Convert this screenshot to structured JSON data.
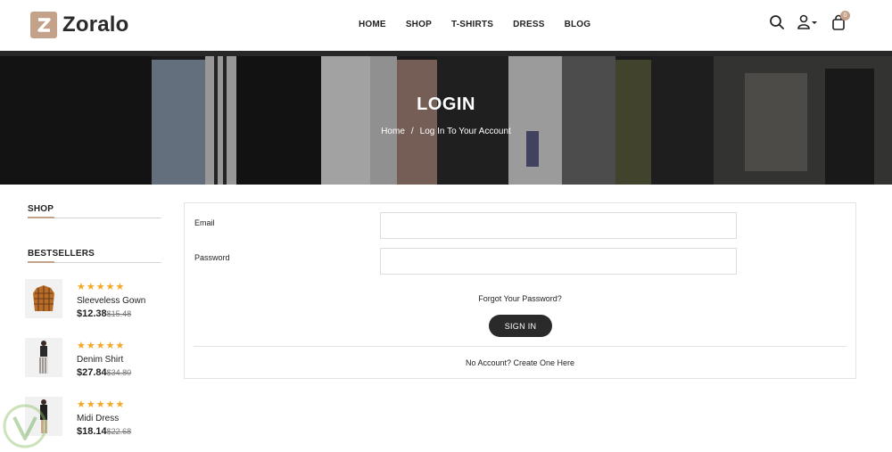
{
  "header": {
    "brand": "Zoralo",
    "logo_letter": "Z",
    "nav": [
      "HOME",
      "SHOP",
      "T-SHIRTS",
      "DRESS",
      "BLOG"
    ],
    "cart_count": "0"
  },
  "banner": {
    "title": "LOGIN",
    "breadcrumb": {
      "home": "Home",
      "separator": "/",
      "current": "Log In To Your Account"
    }
  },
  "sidebar": {
    "shop_title": "SHOP",
    "bestsellers_title": "BESTSELLERS",
    "products": [
      {
        "stars": "★★★★★",
        "name": "Sleeveless Gown",
        "price": "$12.38",
        "old_price": "$15.48",
        "thumb": "jacket"
      },
      {
        "stars": "★★★★★",
        "name": "Denim Shirt",
        "price": "$27.84",
        "old_price": "$34.80",
        "thumb": "model-striped"
      },
      {
        "stars": "★★★★★",
        "name": "Midi Dress",
        "price": "$18.14",
        "old_price": "$22.68",
        "thumb": "model-dark"
      }
    ]
  },
  "form": {
    "email_label": "Email",
    "email_value": "",
    "password_label": "Password",
    "password_value": "",
    "forgot_link": "Forgot Your Password?",
    "signin_label": "SIGN IN",
    "no_account": "No Account? Create One Here"
  },
  "colors": {
    "accent": "#c4a28a",
    "star": "#f5a623",
    "button": "#2a2a2a"
  },
  "icons": [
    "search-icon",
    "user-icon",
    "caret-down-icon",
    "bag-icon",
    "watermark-logo"
  ]
}
